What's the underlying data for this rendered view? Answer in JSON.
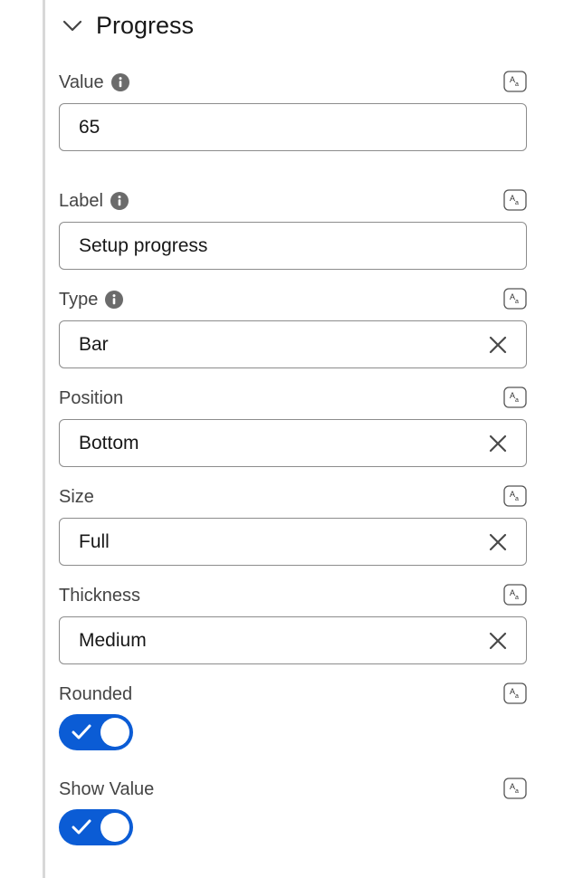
{
  "section": {
    "title": "Progress"
  },
  "fields": {
    "value": {
      "label": "Value",
      "value": "65"
    },
    "label": {
      "label": "Label",
      "value": "Setup progress"
    },
    "type": {
      "label": "Type",
      "value": "Bar"
    },
    "position": {
      "label": "Position",
      "value": "Bottom"
    },
    "size": {
      "label": "Size",
      "value": "Full"
    },
    "thickness": {
      "label": "Thickness",
      "value": "Medium"
    },
    "rounded": {
      "label": "Rounded",
      "enabled": true
    },
    "show_value": {
      "label": "Show Value",
      "enabled": true
    }
  },
  "formula_icon_glyph": "A a",
  "colors": {
    "toggle_on": "#0b5cd5",
    "text": "#181818",
    "label": "#444444",
    "border": "#8c8c8c"
  }
}
